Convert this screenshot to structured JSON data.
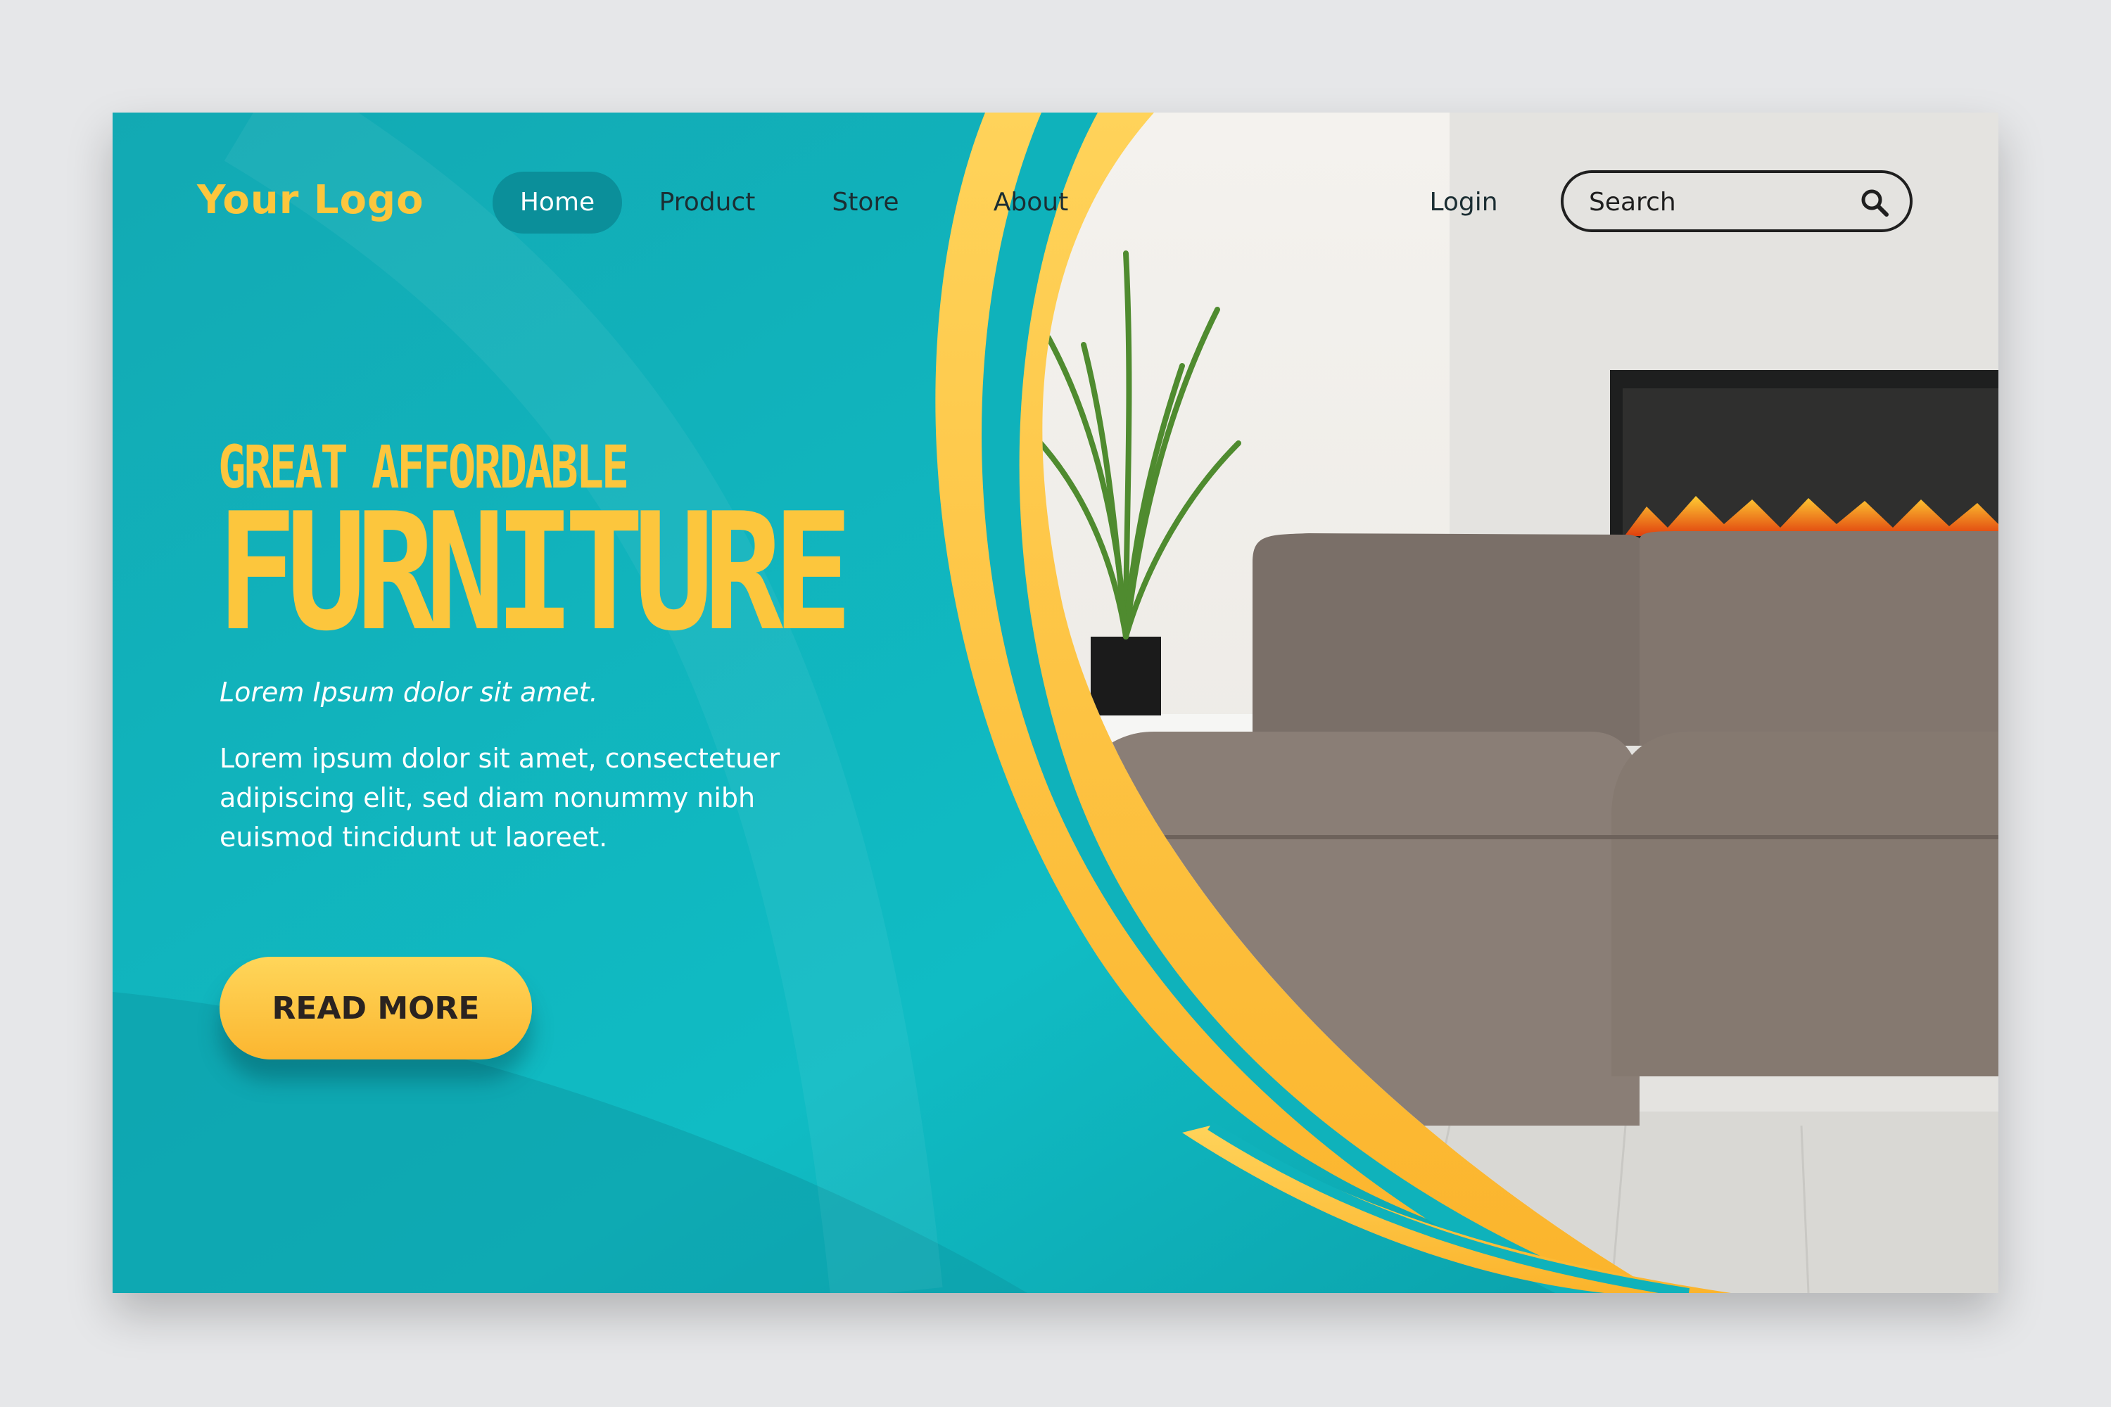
{
  "logo": "Your Logo",
  "nav": {
    "home": "Home",
    "product": "Product",
    "store": "Store",
    "about": "About",
    "login": "Login"
  },
  "search": {
    "placeholder": "Search"
  },
  "hero": {
    "line1": "GREAT AFFORDABLE",
    "line2": "FURNITURE",
    "tagline": "Lorem Ipsum dolor sit amet.",
    "body": "Lorem ipsum dolor sit amet, consectetuer adipiscing elit, sed diam nonummy nibh euismod tincidunt ut laoreet.",
    "cta": "READ MORE"
  },
  "colors": {
    "teal": "#0fb4bd",
    "teal_dark": "#0b8f9a",
    "yellow": "#fcc63d",
    "text_dark": "#1b2e33"
  },
  "icons": {
    "search": "search-icon"
  }
}
